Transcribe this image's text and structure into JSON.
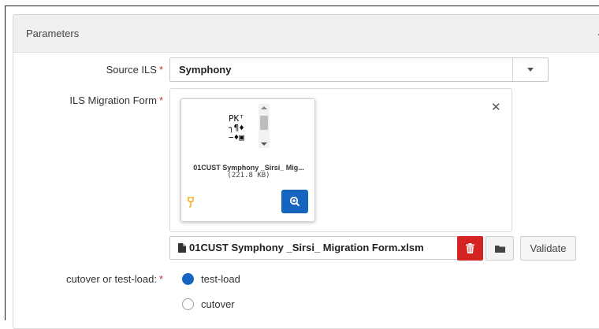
{
  "section": {
    "title": "Parameters"
  },
  "source_ils": {
    "label": "Source ILS",
    "required_mark": "*",
    "value": "Symphony"
  },
  "migration_form": {
    "label": "ILS Migration Form",
    "required_mark": "*",
    "file_card": {
      "name": "01CUST Symphony _Sirsi_ Mig...",
      "size": "(221.8 KB)"
    },
    "file_field_value": "01CUST Symphony _Sirsi_ Migration Form.xlsm",
    "validate_label": "Validate"
  },
  "load_type": {
    "label": "cutover or test-load:",
    "required_mark": "*",
    "options": [
      {
        "label": "test-load",
        "selected": true
      },
      {
        "label": "cutover",
        "selected": false
      }
    ]
  },
  "colors": {
    "primary": "#1565c0",
    "danger": "#d32323",
    "required": "#d32f2f",
    "plugin_icon": "#f0b429"
  },
  "icons": {
    "collapse": "chevron-down-icon",
    "dropdown": "caret-down-icon",
    "close": "close-icon",
    "zoom": "zoom-in-icon",
    "plugin": "plugin-icon",
    "file": "file-icon",
    "delete": "trash-icon",
    "browse": "folder-icon"
  }
}
